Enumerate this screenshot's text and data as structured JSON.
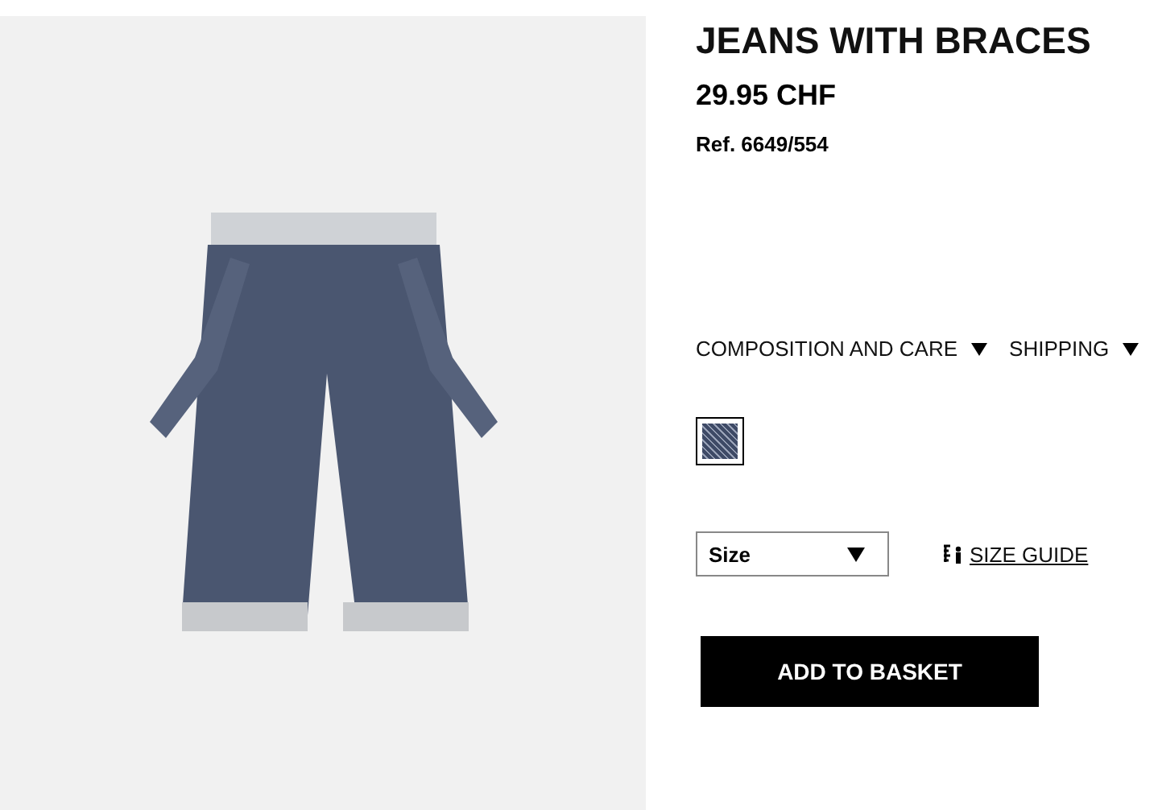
{
  "product": {
    "title": "JEANS WITH BRACES",
    "price": "29.95 CHF",
    "reference": "Ref. 6649/554"
  },
  "info_links": [
    {
      "label": "COMPOSITION AND CARE",
      "expanded": false
    },
    {
      "label": "SHIPPING",
      "expanded": false
    }
  ],
  "swatches": [
    {
      "selected": true,
      "color": "#3e4a66"
    }
  ],
  "size_select": {
    "placeholder": "Size"
  },
  "size_guide": {
    "label": "SIZE GUIDE"
  },
  "add_button": {
    "label": "ADD TO BASKET"
  }
}
